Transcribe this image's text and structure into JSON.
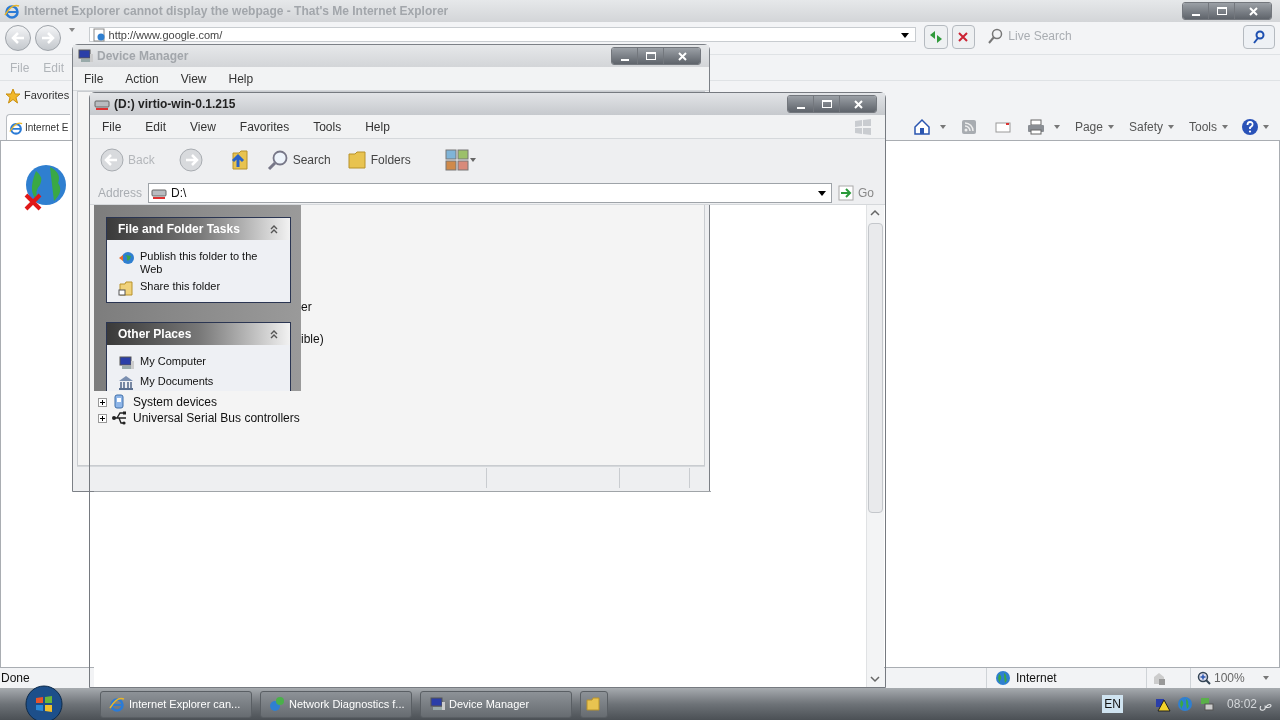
{
  "browser": {
    "title": "Internet Explorer cannot display the webpage - That's Me Internet Explorer",
    "active": false,
    "address": "http://www.google.com/",
    "search_placeholder": "Live Search",
    "menu": [
      "File",
      "Edit"
    ],
    "favorites_label": "Favorites",
    "tabs": [
      {
        "label": "Internet E",
        "selected": true
      }
    ],
    "command_bar": [
      {
        "kind": "home"
      },
      {
        "kind": "feeds"
      },
      {
        "kind": "mail"
      },
      {
        "kind": "print"
      },
      {
        "kind": "menu",
        "label": "Page"
      },
      {
        "kind": "menu",
        "label": "Safety"
      },
      {
        "kind": "menu",
        "label": "Tools"
      },
      {
        "kind": "help"
      }
    ],
    "status": "Done",
    "zone": "Internet",
    "zoom": "100%"
  },
  "device_manager": {
    "title": "Device Manager",
    "active": false,
    "menu": [
      "File",
      "Action",
      "View",
      "Help"
    ],
    "fragments": [
      "er",
      "ible)"
    ],
    "tree": [
      {
        "label": "System devices",
        "expanded": false
      },
      {
        "label": "Universal Serial Bus controllers",
        "expanded": false
      }
    ]
  },
  "explorer": {
    "title": "(D:) virtio-win-0.1.215",
    "active": true,
    "menu": [
      "File",
      "Edit",
      "View",
      "Favorites",
      "Tools",
      "Help"
    ],
    "toolbar": [
      {
        "kind": "back",
        "label": "Back",
        "disabled": true
      },
      {
        "kind": "forward",
        "disabled": false
      },
      {
        "kind": "up",
        "disabled": false
      },
      {
        "kind": "search",
        "label": "Search",
        "disabled": false
      },
      {
        "kind": "folders",
        "label": "Folders",
        "disabled": false
      },
      {
        "kind": "views",
        "disabled": false
      }
    ],
    "address_label": "Address",
    "address": "D:\\",
    "go": "Go",
    "task_panels": [
      {
        "title": "File and Folder Tasks",
        "expanded": true,
        "items": [
          "Publish this folder to the Web",
          "Share this folder"
        ]
      },
      {
        "title": "Other Places",
        "expanded": true,
        "items": [
          "My Computer",
          "My Documents"
        ]
      }
    ]
  },
  "taskbar": {
    "buttons": [
      {
        "kind": "labelled",
        "label": "Internet Explorer can..."
      },
      {
        "kind": "labelled",
        "label": "Network Diagnostics f..."
      },
      {
        "kind": "labelled",
        "label": "Device Manager"
      },
      {
        "kind": "icon"
      }
    ],
    "language": "EN",
    "clock": "08:02",
    "clock_suffix": "ص"
  }
}
